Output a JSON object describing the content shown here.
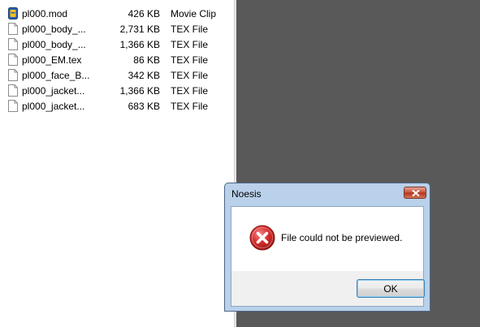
{
  "files": [
    {
      "name": "pl000.mod",
      "size": "426 KB",
      "type": "Movie Clip",
      "icon": "movie-clip-file-icon"
    },
    {
      "name": "pl000_body_...",
      "size": "2,731 KB",
      "type": "TEX File",
      "icon": "generic-file-icon"
    },
    {
      "name": "pl000_body_...",
      "size": "1,366 KB",
      "type": "TEX File",
      "icon": "generic-file-icon"
    },
    {
      "name": "pl000_EM.tex",
      "size": "86 KB",
      "type": "TEX File",
      "icon": "generic-file-icon"
    },
    {
      "name": "pl000_face_B...",
      "size": "342 KB",
      "type": "TEX File",
      "icon": "generic-file-icon"
    },
    {
      "name": "pl000_jacket...",
      "size": "1,366 KB",
      "type": "TEX File",
      "icon": "generic-file-icon"
    },
    {
      "name": "pl000_jacket...",
      "size": "683 KB",
      "type": "TEX File",
      "icon": "generic-file-icon"
    }
  ],
  "dialog": {
    "title": "Noesis",
    "message": "File could not be previewed.",
    "ok_label": "OK",
    "icon": "error-icon"
  },
  "colors": {
    "background": "#595959",
    "error_red": "#d62d2d",
    "dialog_frame": "#b9d1ea"
  }
}
